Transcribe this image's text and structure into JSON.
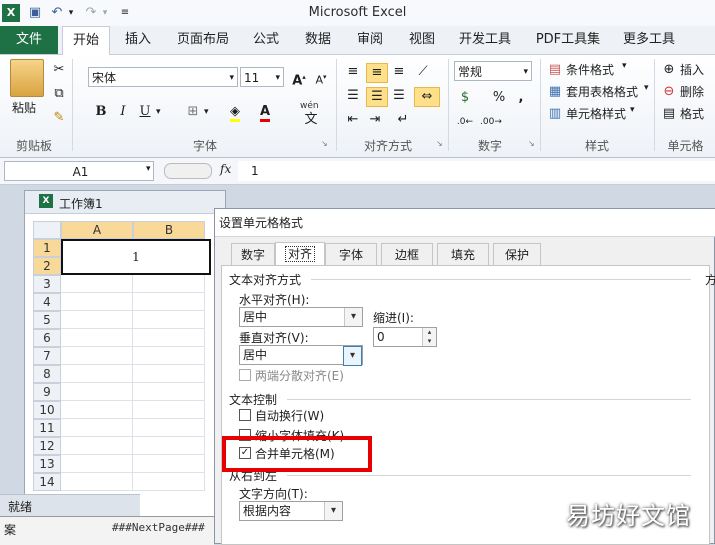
{
  "app_title": "Microsoft Excel",
  "tabs": [
    "文件",
    "开始",
    "插入",
    "页面布局",
    "公式",
    "数据",
    "审阅",
    "视图",
    "开发工具",
    "PDF工具集",
    "更多工具"
  ],
  "ribbon": {
    "paste_label": "粘贴",
    "clipboard_label": "剪贴板",
    "font_name": "宋体",
    "font_size": "11",
    "bold": "B",
    "italic": "I",
    "underline": "U",
    "font_label": "字体",
    "align_label": "对齐方式",
    "number_format": "常规",
    "percent": "%",
    "comma": ",",
    "number_label": "数字",
    "cond_format": "条件格式",
    "table_format": "套用表格格式",
    "cell_style": "单元格样式",
    "style_label": "样式",
    "insert": "插入",
    "delete": "删除",
    "format": "格式",
    "cells_label": "单元格",
    "wen_label": "wén"
  },
  "formula_bar": {
    "name_box": "A1",
    "fx": "fx",
    "value": "1"
  },
  "workbook": {
    "title": "工作簿1",
    "columns": [
      "A",
      "B"
    ],
    "rows": [
      "1",
      "2",
      "3",
      "4",
      "5",
      "6",
      "7",
      "8",
      "9",
      "10",
      "11",
      "12",
      "13",
      "14"
    ],
    "cell_value": "1"
  },
  "status": {
    "ready": "就绪",
    "next_page": "###NextPage###",
    "left_char": "案"
  },
  "dialog": {
    "title": "设置单元格格式",
    "tabs": [
      "数字",
      "对齐",
      "字体",
      "边框",
      "填充",
      "保护"
    ],
    "text_align_section": "文本对齐方式",
    "horizontal_label": "水平对齐(H):",
    "horizontal_value": "居中",
    "indent_label": "缩进(I):",
    "indent_value": "0",
    "vertical_label": "垂直对齐(V):",
    "vertical_value": "居中",
    "distributed_label": "两端分散对齐(E)",
    "text_control_section": "文本控制",
    "wrap_label": "自动换行(W)",
    "shrink_label": "缩小字体填充(K)",
    "merge_label": "合并单元格(M)",
    "rtl_section": "从右到左",
    "direction_label": "文字方向(T):",
    "direction_value": "根据内容",
    "orientation_char": "方"
  },
  "watermark": "易坊好文馆",
  "colors": {
    "file_tab": "#1e7145",
    "highlight": "#e60000"
  }
}
